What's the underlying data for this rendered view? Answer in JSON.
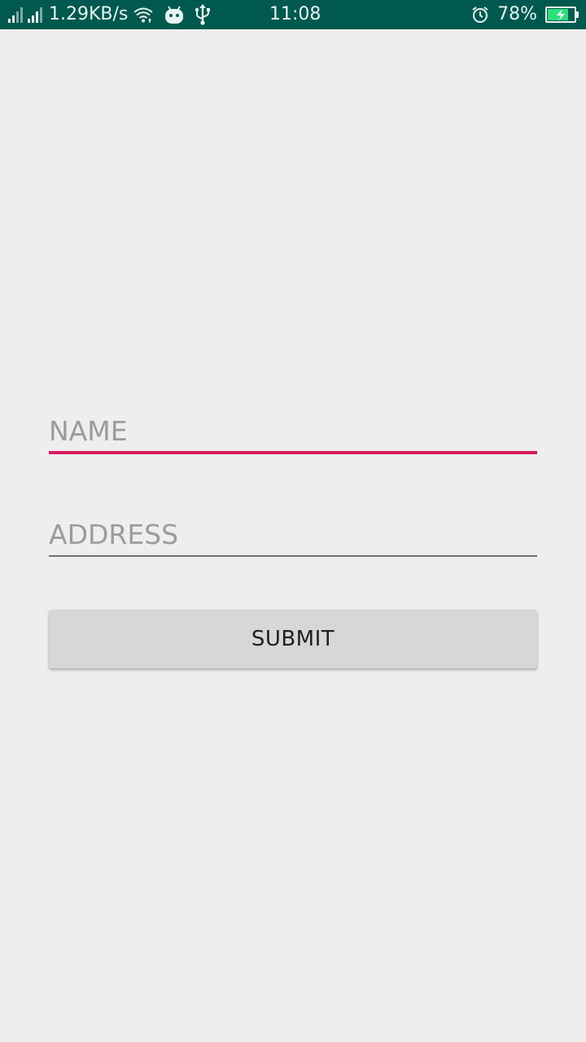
{
  "status_bar": {
    "network_speed": "1.29KB/s",
    "time": "11:08",
    "battery_percent": "78%",
    "battery_level": 0.78,
    "icons": [
      "signal-1-icon",
      "signal-2-icon",
      "wifi-icon",
      "android-debug-icon",
      "usb-icon",
      "alarm-icon",
      "battery-charging-icon"
    ],
    "colors": {
      "background": "#00594e",
      "foreground": "#e8f4f1",
      "battery_fill": "#2ee07a"
    }
  },
  "form": {
    "name_field": {
      "placeholder": "NAME",
      "value": "",
      "focused": true
    },
    "address_field": {
      "placeholder": "ADDRESS",
      "value": ""
    },
    "submit_label": "SUBMIT"
  },
  "colors": {
    "page_background": "#eeeeee",
    "accent": "#d81b60",
    "button_background": "#d6d7d7"
  }
}
